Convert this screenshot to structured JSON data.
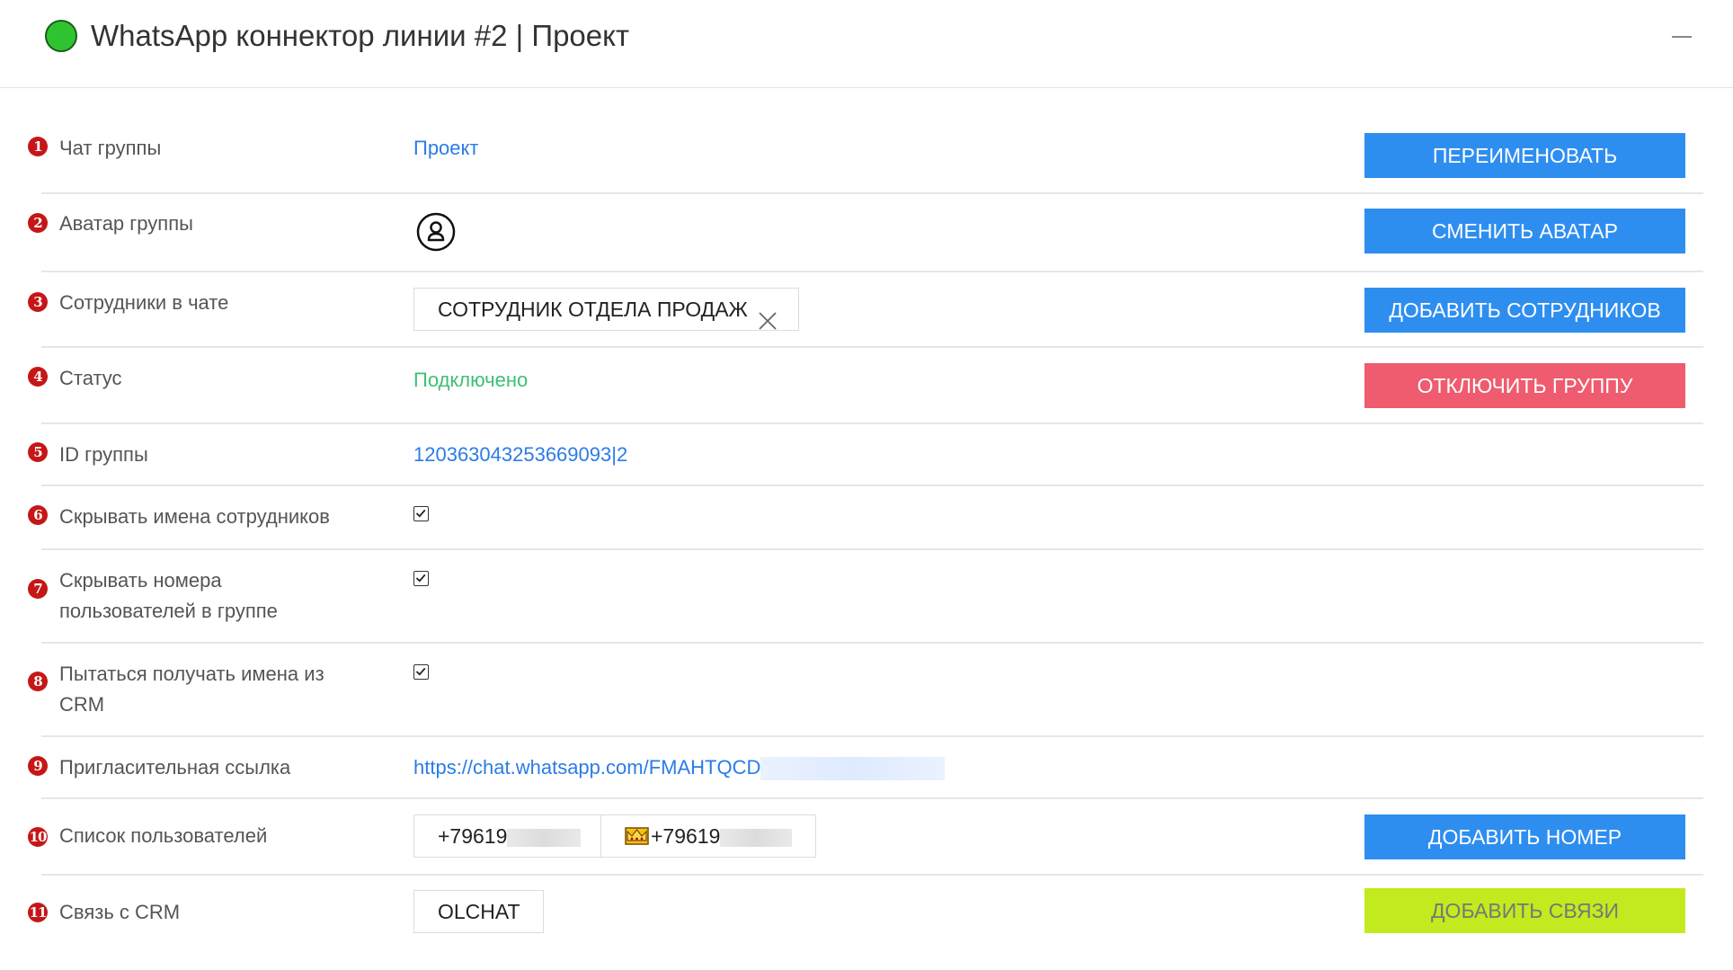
{
  "header": {
    "title": "WhatsApp коннектор линии #2 | Проект",
    "status_color": "#2fc42f"
  },
  "rows": {
    "chat": {
      "num": "1",
      "label": "Чат группы",
      "value": "Проект",
      "button": "ПЕРЕИМЕНОВАТЬ"
    },
    "avatar": {
      "num": "2",
      "label": "Аватар группы",
      "icon": "user-circle-icon",
      "button": "СМЕНИТЬ АВАТАР"
    },
    "staff": {
      "num": "3",
      "label": "Сотрудники в чате",
      "tag": "СОТРУДНИК ОТДЕЛА ПРОДАЖ",
      "button": "ДОБАВИТЬ СОТРУДНИКОВ"
    },
    "status": {
      "num": "4",
      "label": "Статус",
      "value": "Подключено",
      "button": "ОТКЛЮЧИТЬ ГРУППУ"
    },
    "group_id": {
      "num": "5",
      "label": "ID группы",
      "value": "120363043253669093|2"
    },
    "hide_names": {
      "num": "6",
      "label": "Скрывать имена сотрудников",
      "checked": true
    },
    "hide_numbers": {
      "num": "7",
      "label_line1": "Скрывать номера",
      "label_line2": "пользователей в группе",
      "checked": true
    },
    "crm_names": {
      "num": "8",
      "label_line1": "Пытаться получать имена из",
      "label_line2": "CRM",
      "checked": true
    },
    "invite": {
      "num": "9",
      "label": "Пригласительная ссылка",
      "value": "https://chat.whatsapp.com/FMAHTQCD"
    },
    "users": {
      "num": "10",
      "label": "Список пользователей",
      "user1": "+79619",
      "user2": "+79619",
      "user2_icon": "crown-icon",
      "button": "ДОБАВИТЬ НОМЕР"
    },
    "crm": {
      "num": "11",
      "label": "Связь с CRM",
      "tag": "OLCHAT",
      "button": "ДОБАВИТЬ СВЯЗИ"
    }
  },
  "colors": {
    "link": "#2b7ce6",
    "connected": "#3dbf74",
    "button_blue": "#2e8ef0",
    "button_red": "#ef5b6f",
    "button_lime": "#c3ea1e",
    "badge_red": "#c51717"
  }
}
